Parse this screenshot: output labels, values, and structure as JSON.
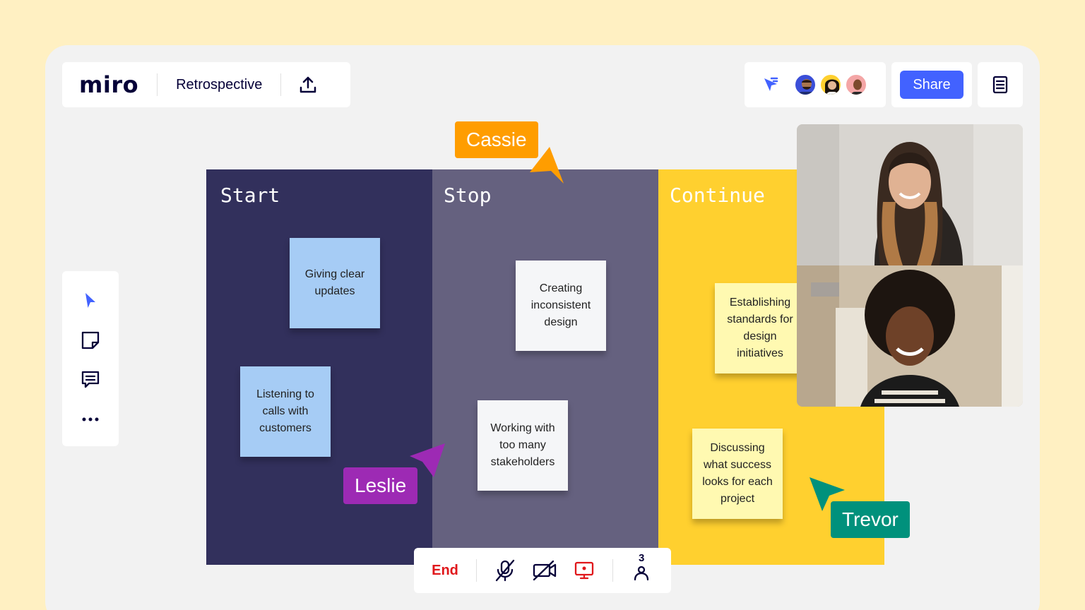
{
  "app": {
    "logo": "miro",
    "board_title": "Retrospective"
  },
  "toolbar_top": {
    "upload_icon": "upload-icon"
  },
  "collab": {
    "cursor_icon": "cursor-sharing-icon",
    "avatars": [
      "avatar-1",
      "avatar-2",
      "avatar-3"
    ]
  },
  "share": {
    "label": "Share"
  },
  "notes_icon": "notes-icon",
  "left_tools": [
    "select-icon",
    "sticky-note-icon",
    "comment-icon",
    "more-icon"
  ],
  "columns": [
    {
      "title": "Start",
      "color": "#32305c"
    },
    {
      "title": "Stop",
      "color": "#65617f"
    },
    {
      "title": "Continue",
      "color": "#ffd02f"
    }
  ],
  "stickies": {
    "start_1": "Giving clear updates",
    "start_2": "Listening to calls with customers",
    "stop_1": "Creating inconsistent design",
    "stop_2": "Working with too many stakeholders",
    "continue_1": "Establishing standards for design initiatives",
    "continue_2": "Discussing what success looks for each project"
  },
  "cursors": {
    "cassie": {
      "name": "Cassie",
      "color": "#ff9d00"
    },
    "leslie": {
      "name": "Leslie",
      "color": "#9d2ab4"
    },
    "trevor": {
      "name": "Trevor",
      "color": "#00917c"
    }
  },
  "callbar": {
    "end_label": "End",
    "participants_count": "3",
    "icons": [
      "mic-off-icon",
      "camera-off-icon",
      "screen-share-icon",
      "participants-icon"
    ]
  },
  "colors": {
    "accent": "#4262ff",
    "end": "#e0171b"
  }
}
